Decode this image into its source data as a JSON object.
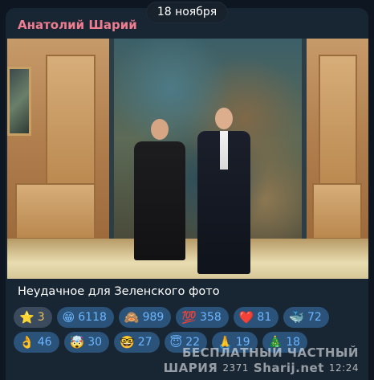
{
  "date_label": "18 ноября",
  "message": {
    "author": "Анатолий Шарий",
    "photo_alt": "",
    "caption": "Неудачное для Зеленского фото",
    "reactions": [
      {
        "emoji": "⭐",
        "icon": "star-icon",
        "count": "3",
        "active": true
      },
      {
        "emoji": "😁",
        "icon": "grinning-face-icon",
        "count": "6118"
      },
      {
        "emoji": "🙈",
        "icon": "see-no-evil-monkey-icon",
        "count": "989"
      },
      {
        "emoji": "💯",
        "icon": "hundred-points-icon",
        "count": "358"
      },
      {
        "emoji": "❤️",
        "icon": "red-heart-icon",
        "count": "81"
      },
      {
        "emoji": "🐳",
        "icon": "whale-icon",
        "count": "72"
      },
      {
        "emoji": "👌",
        "icon": "ok-hand-icon",
        "count": "46"
      },
      {
        "emoji": "🤯",
        "icon": "exploding-head-icon",
        "count": "30"
      },
      {
        "emoji": "🤓",
        "icon": "nerd-face-icon",
        "count": "27"
      },
      {
        "emoji": "😇",
        "icon": "halo-face-icon",
        "count": "22"
      },
      {
        "emoji": "🙏",
        "icon": "folded-hands-icon",
        "count": "19"
      },
      {
        "emoji": "🎄",
        "icon": "christmas-tree-icon",
        "count": "18"
      }
    ],
    "watermark_line1": "БЕСПЛАТНЫЙ ЧАСТНЫЙ",
    "watermark_line2": "ШАРИЯ",
    "watermark_site": "Sharij.net",
    "views": "2371",
    "time": "12:24"
  }
}
